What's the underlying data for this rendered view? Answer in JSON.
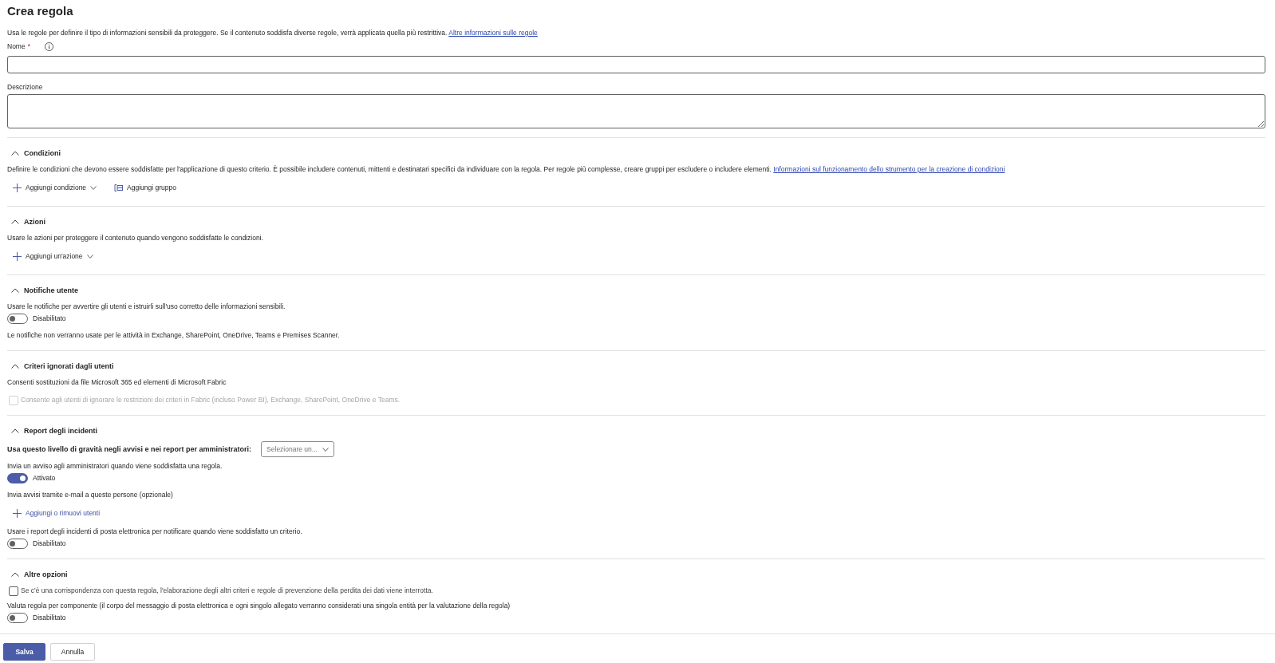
{
  "page": {
    "title": "Crea regola",
    "intro": "Usa le regole per definire il tipo di informazioni sensibili da proteggere. Se il contenuto soddisfa diverse regole, verrà applicata quella più restrittiva.",
    "intro_link": "Altre informazioni sulle regole"
  },
  "fields": [
    {
      "kind": "input",
      "label": "Nome",
      "required_mark": "*",
      "info": true
    },
    {
      "kind": "textarea",
      "label": "Descrizione",
      "info": false
    }
  ],
  "sections": [
    {
      "title": "Condizioni",
      "expanded": true,
      "items": [
        {
          "kind": "text",
          "text": "Definire le condizioni che devono essere soddisfatte per l'applicazione di questo criterio. È possibile includere contenuti, mittenti e destinatari specifici da individuare con la regola. Per regole più complesse, creare gruppi per escludere o includere elementi.",
          "link": "Informazioni sul funzionamento dello strumento per la creazione di condizioni"
        },
        {
          "kind": "buttons",
          "buttons": [
            {
              "kind": "add",
              "label": "Aggiungi condizione",
              "dropdown": true
            },
            {
              "kind": "group",
              "label": "Aggiungi gruppo",
              "dropdown": false
            }
          ]
        }
      ]
    },
    {
      "title": "Azioni",
      "expanded": true,
      "items": [
        {
          "kind": "text",
          "text": "Usare le azioni per proteggere il contenuto quando vengono soddisfatte le condizioni."
        },
        {
          "kind": "buttons",
          "buttons": [
            {
              "kind": "add",
              "label": "Aggiungi un'azione",
              "dropdown": true
            }
          ]
        }
      ]
    },
    {
      "title": "Notifiche utente",
      "expanded": true,
      "items": [
        {
          "kind": "text",
          "text": "Usare le notifiche per avvertire gli utenti e istruirli sull'uso corretto delle informazioni sensibili."
        },
        {
          "kind": "toggle",
          "on": false,
          "label": "Disabilitato"
        },
        {
          "kind": "text",
          "text": "Le notifiche non verranno usate per le attività in Exchange, SharePoint, OneDrive, Teams e Premises Scanner."
        }
      ]
    },
    {
      "title": "Criteri ignorati dagli utenti",
      "expanded": true,
      "items": [
        {
          "kind": "text",
          "text": "Consenti sostituzioni da file Microsoft 365 ed elementi di Microsoft Fabric"
        },
        {
          "kind": "checkbox",
          "checked": false,
          "disabled": true,
          "label": "Consente agli utenti di ignorare le restrizioni dei criteri in Fabric (incluso Power BI), Exchange, SharePoint, OneDrive e Teams."
        }
      ]
    },
    {
      "title": "Report degli incidenti",
      "expanded": true,
      "items": [
        {
          "kind": "select",
          "label": "Usa questo livello di gravità negli avvisi e nei report per amministratori:",
          "placeholder": "Selezionare un..."
        },
        {
          "kind": "text",
          "text": "Invia un avviso agli amministratori quando viene soddisfatta una regola."
        },
        {
          "kind": "toggle",
          "on": true,
          "label": "Attivato"
        },
        {
          "kind": "text",
          "text": "Invia avvisi tramite e-mail a queste persone (opzionale)"
        },
        {
          "kind": "buttons",
          "buttons": [
            {
              "kind": "addlink",
              "label": "Aggiungi o rimuovi utenti",
              "dropdown": false
            }
          ]
        },
        {
          "kind": "text",
          "text": "Usare i report degli incidenti di posta elettronica per notificare quando viene soddisfatto un criterio."
        },
        {
          "kind": "toggle",
          "on": false,
          "label": "Disabilitato"
        }
      ]
    },
    {
      "title": "Altre opzioni",
      "expanded": true,
      "items": [
        {
          "kind": "checkbox",
          "checked": false,
          "disabled": false,
          "label": "Se c'è una corrispondenza con questa regola, l'elaborazione degli altri criteri e regole di prevenzione della perdita dei dati viene interrotta."
        },
        {
          "kind": "text",
          "text": "Valuta regola per componente (il corpo del messaggio di posta elettronica e ogni singolo allegato verranno considerati una singola entità per la valutazione della regola)"
        },
        {
          "kind": "toggle",
          "on": false,
          "label": "Disabilitato"
        }
      ]
    }
  ],
  "footer": {
    "buttons": [
      {
        "kind": "primary",
        "label": "Salva"
      },
      {
        "kind": "secondary",
        "label": "Annulla"
      }
    ]
  }
}
